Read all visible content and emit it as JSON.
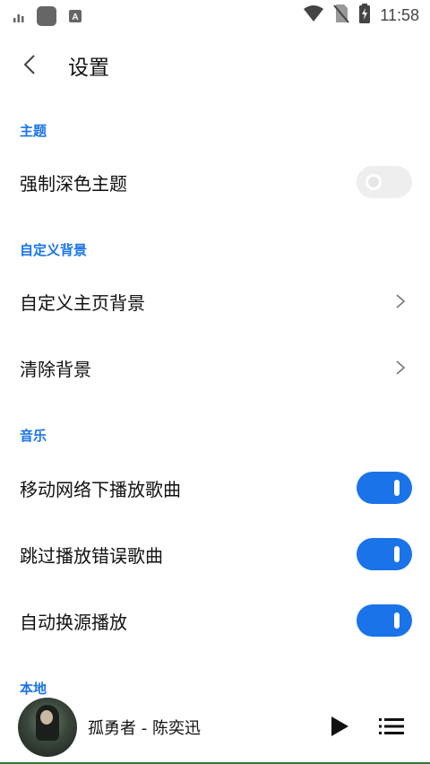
{
  "status_bar": {
    "time": "11:58"
  },
  "header": {
    "title": "设置"
  },
  "sections": {
    "theme": {
      "title": "主题",
      "items": [
        {
          "label": "强制深色主题",
          "enabled": false
        }
      ]
    },
    "background": {
      "title": "自定义背景",
      "items": [
        {
          "label": "自定义主页背景"
        },
        {
          "label": "清除背景"
        }
      ]
    },
    "music": {
      "title": "音乐",
      "items": [
        {
          "label": "移动网络下播放歌曲",
          "enabled": true
        },
        {
          "label": "跳过播放错误歌曲",
          "enabled": true
        },
        {
          "label": "自动换源播放",
          "enabled": true
        }
      ]
    },
    "local": {
      "title": "本地"
    }
  },
  "player": {
    "song": "孤勇者 - 陈奕迅"
  },
  "colors": {
    "accent": "#1a73e8",
    "toggle_off": "#eeeeee"
  }
}
